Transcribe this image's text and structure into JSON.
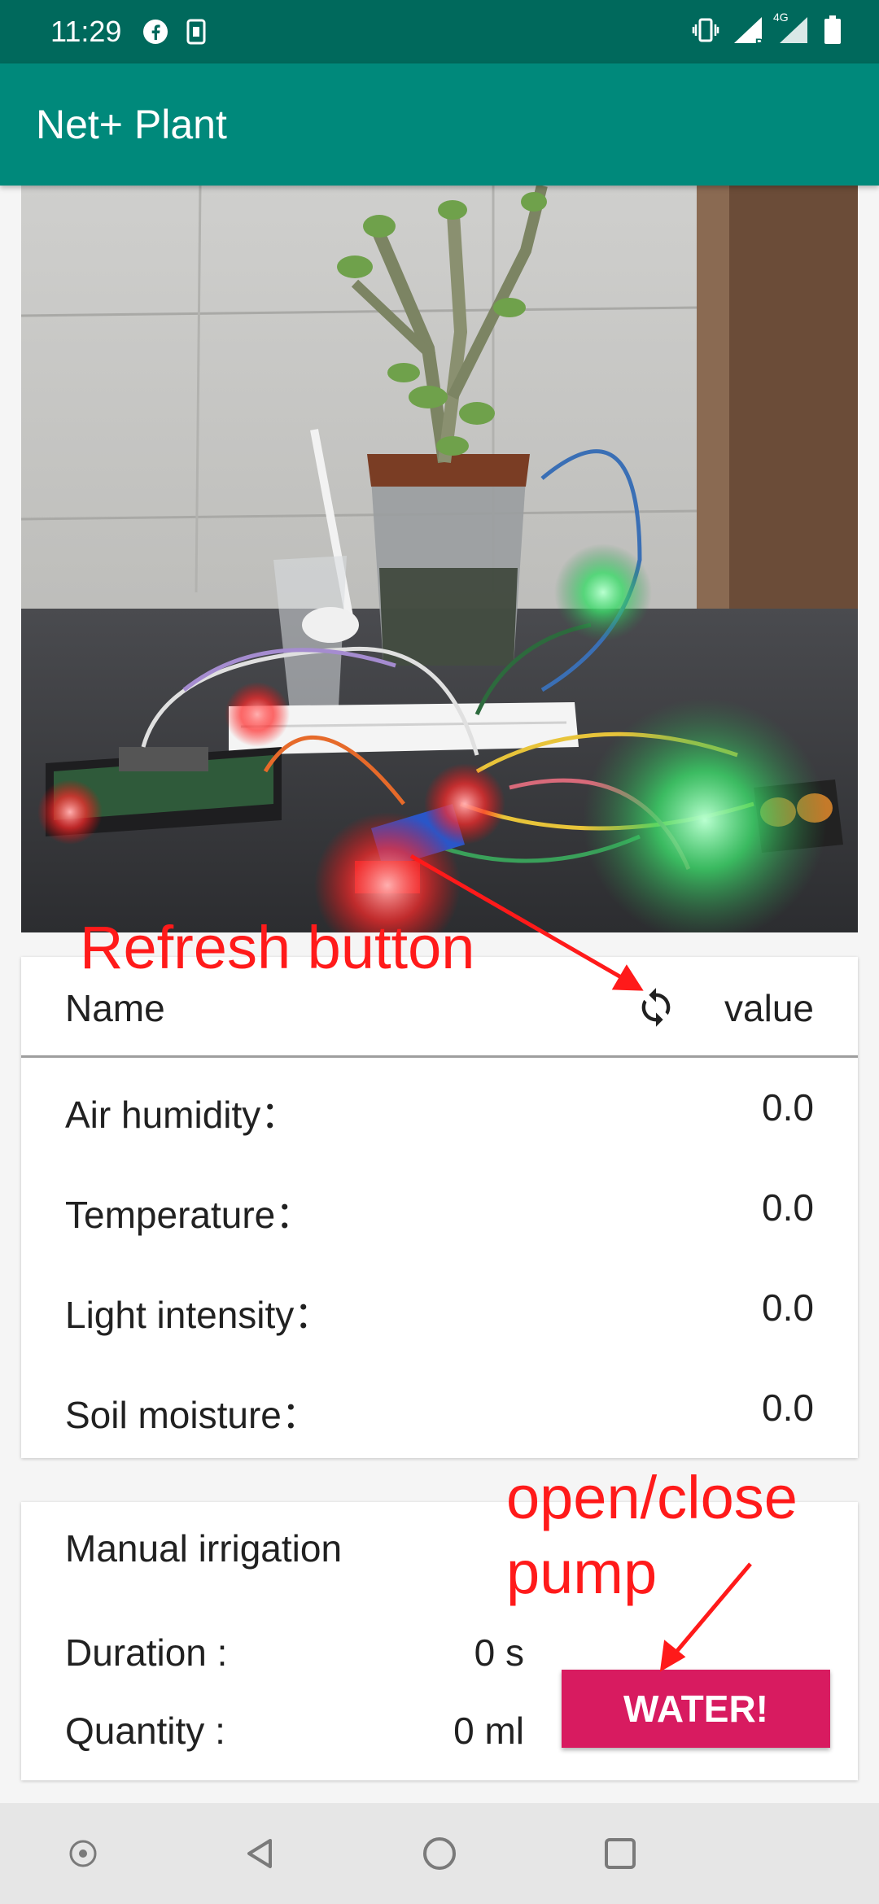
{
  "status_bar": {
    "time": "11:29",
    "left_icons": [
      "facebook-icon",
      "sim-notification-icon"
    ],
    "right_icons": [
      "vibrate-icon",
      "signal-roaming-icon",
      "signal-4g-icon",
      "battery-icon"
    ],
    "network_label": "4G",
    "roaming_label": "R"
  },
  "app_bar": {
    "title": "Net+ Plant"
  },
  "sensor_table": {
    "header_name": "Name",
    "header_value": "value",
    "refresh_icon": "refresh-icon",
    "rows": [
      {
        "label": "Air humidity：",
        "value": "0.0"
      },
      {
        "label": "Temperature：",
        "value": "0.0"
      },
      {
        "label": "Light intensity：",
        "value": "0.0"
      },
      {
        "label": "Soil moisture：",
        "value": "0.0"
      }
    ]
  },
  "irrigation": {
    "title": "Manual irrigation",
    "duration_label": "Duration :",
    "duration_value": "0 s",
    "quantity_label": "Quantity :",
    "quantity_value": "0 ml",
    "button_label": "WATER!"
  },
  "annotations": {
    "refresh": "Refresh button",
    "pump_line1": "open/close",
    "pump_line2": "pump"
  },
  "nav_bar": {
    "icons": [
      "accessibility-dot-icon",
      "back-icon",
      "home-icon",
      "recents-icon"
    ]
  },
  "colors": {
    "status_bar": "#00695c",
    "app_bar": "#00897b",
    "water_button": "#d81b60",
    "annotation": "#ff1a1a"
  }
}
